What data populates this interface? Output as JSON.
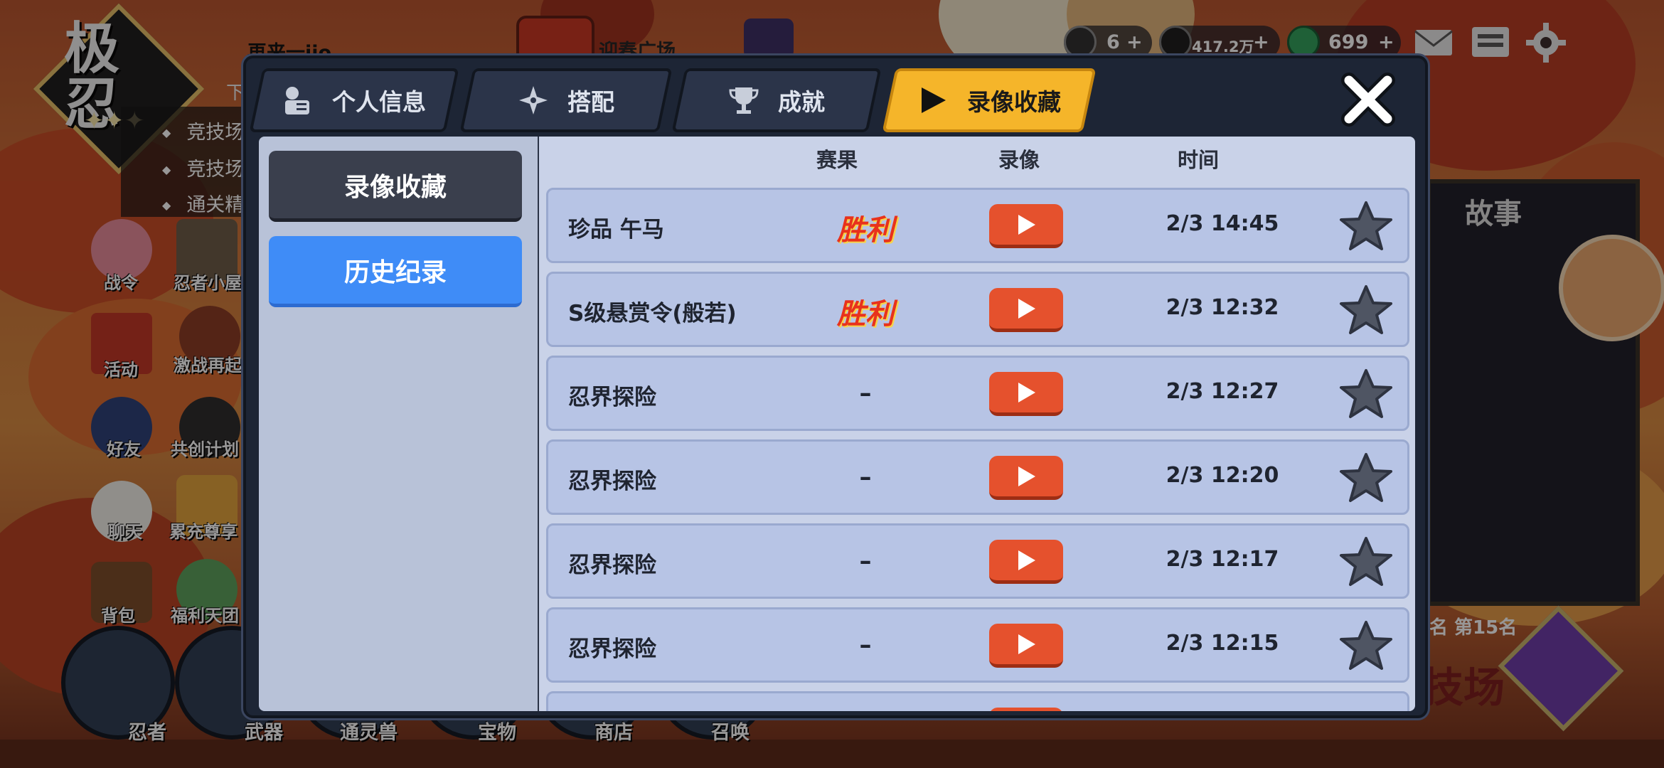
{
  "background": {
    "player_name": "再来一jio",
    "player_sub": "下",
    "quests": [
      "竞技场",
      "竞技场",
      "通关精"
    ],
    "event_label": "迎春广场",
    "hud": {
      "currency1": "6",
      "currency2": "417.2万",
      "currency3": "699",
      "plus": "+"
    },
    "side_menu": [
      "战令",
      "忍者小屋",
      "活动",
      "激战再起",
      "好友",
      "共创计划",
      "聊天",
      "累充尊享",
      "背包",
      "福利天团"
    ],
    "bottom_menu": [
      "忍者",
      "武器",
      "通灵兽",
      "宝物",
      "商店",
      "召唤"
    ],
    "story_title": "故事",
    "rank_text": "名 第15名",
    "arena_text": "技场",
    "logo_text": "极忍"
  },
  "modal": {
    "tabs": [
      {
        "label": "个人信息",
        "icon": "profile-icon",
        "active": false
      },
      {
        "label": "搭配",
        "icon": "shuriken-icon",
        "active": false
      },
      {
        "label": "成就",
        "icon": "trophy-icon",
        "active": false
      },
      {
        "label": "录像收藏",
        "icon": "play-icon",
        "active": true
      }
    ],
    "close_icon": "close-icon",
    "sub_tabs": [
      {
        "label": "录像收藏",
        "style": "dark"
      },
      {
        "label": "历史纪录",
        "style": "blue"
      }
    ],
    "columns": {
      "result": "赛果",
      "video": "录像",
      "time": "时间"
    },
    "rows": [
      {
        "name": "珍品 午马",
        "result": "胜利",
        "time": "2/3 14:45"
      },
      {
        "name": "S级悬赏令(般若)",
        "result": "胜利",
        "time": "2/3 12:32"
      },
      {
        "name": "忍界探险",
        "result": "–",
        "time": "2/3 12:27"
      },
      {
        "name": "忍界探险",
        "result": "–",
        "time": "2/3 12:20"
      },
      {
        "name": "忍界探险",
        "result": "–",
        "time": "2/3 12:17"
      },
      {
        "name": "忍界探险",
        "result": "–",
        "time": "2/3 12:15"
      }
    ],
    "colors": {
      "accent_tab": "#f5b52a",
      "play_button": "#e5512d",
      "history_tab": "#3f8cf7",
      "star": "#4f5563"
    }
  }
}
